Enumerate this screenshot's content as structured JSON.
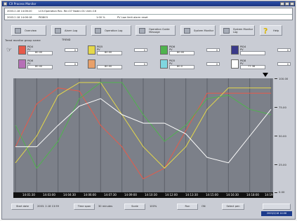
{
  "window": {
    "title": "CX Process Monitor"
  },
  "messages": [
    {
      "time": "2003.2.18 14:06:20",
      "text": "LCS:Operation Rec. Re=07 Node=01 Unit=16",
      "tag": "",
      "pct": "",
      "desc": ""
    },
    {
      "time": "2003.2.18 14:06:18",
      "text": "PID803",
      "tag": "",
      "pct": "1:00 %",
      "desc": "PV Low limit alarm reset"
    }
  ],
  "toolbar": [
    {
      "label": "Overview"
    },
    {
      "label": "Alarm Log"
    },
    {
      "label": "Operation Log"
    },
    {
      "label": "Operation Guide Message"
    },
    {
      "label": "System Monitor"
    },
    {
      "label": "System Monitor Log"
    },
    {
      "label": "Help"
    }
  ],
  "panel": {
    "title": "Trend monitor group name",
    "pager": "TREND"
  },
  "pens": [
    {
      "tag": "PID4 PV",
      "value": "80.00",
      "unit": "0",
      "color": "#e65a4a"
    },
    {
      "tag": "PID5 PV",
      "value": "80.00",
      "unit": "0",
      "color": "#e5d84a"
    },
    {
      "tag": "PID6 PV",
      "value": "80.00",
      "unit": "0",
      "color": "#4fb34e"
    },
    {
      "tag": "PID4 PV",
      "value": "",
      "unit": "0",
      "color": "#3a3a8a"
    },
    {
      "tag": "PID6 PV",
      "value": "80.00",
      "unit": "0",
      "color": "#b66fb7"
    },
    {
      "tag": "",
      "value": "80.00",
      "unit": "0",
      "color": "#e8a06a"
    },
    {
      "tag": "PID5 PV",
      "value": "80.0",
      "unit": "0",
      "color": "#7fd6e0"
    },
    {
      "tag": "PID8 PV",
      "value": "77.36",
      "unit": "0",
      "color": "#ffffff"
    }
  ],
  "yaxis": {
    "ticks": [
      "100.00",
      "75.00",
      "50.00",
      "25.00",
      "0.00"
    ]
  },
  "timeaxis": {
    "labels": [
      "14:01:30",
      "14:03:00",
      "14:04:30",
      "14:06:00",
      "14:07:30",
      "14:09:00",
      "14:10:30",
      "14:12:00",
      "14:13:30",
      "14:15:00",
      "14:16:30",
      "14:18:00",
      "14:19"
    ]
  },
  "status": {
    "date_button": "Start date",
    "date_value": "2003. 2.18 13:59",
    "span_button": "Time span",
    "span_value": "30 minutes",
    "scale_button": "Scale",
    "scale_value": "100%",
    "run_button": "Run",
    "run_value": "ON",
    "select_button": "Select pen",
    "clock": "2003/2/18 14:06"
  },
  "chart_data": {
    "type": "line",
    "x": [
      "14:01:30",
      "14:03:00",
      "14:04:30",
      "14:06:00",
      "14:07:30",
      "14:09:00",
      "14:10:30",
      "14:12:00",
      "14:13:30",
      "14:15:00",
      "14:16:30",
      "14:18:00",
      "14:19"
    ],
    "ylim": [
      0,
      100
    ],
    "series": [
      {
        "values": [
          40,
          80,
          95,
          92,
          60,
          40,
          10,
          20,
          55,
          90,
          90,
          90,
          90
        ]
      },
      {
        "values": [
          25,
          50,
          88,
          100,
          100,
          70,
          40,
          20,
          40,
          75,
          95,
          95,
          95
        ]
      },
      {
        "values": [
          60,
          20,
          45,
          85,
          100,
          100,
          70,
          45,
          60,
          85,
          88,
          75,
          70
        ]
      },
      {
        "values": [
          40,
          40,
          60,
          78,
          85,
          70,
          62,
          62,
          52,
          30,
          25,
          50,
          75
        ]
      }
    ]
  }
}
